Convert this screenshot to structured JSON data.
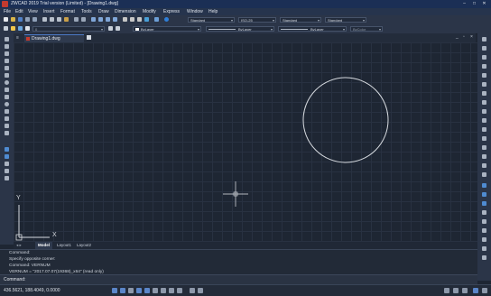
{
  "window": {
    "title": "ZWCAD 2019 Trial version (Limited) - [Drawing1.dwg]",
    "controls": {
      "minimize": "–",
      "maximize": "□",
      "close": "✕"
    }
  },
  "menu": [
    "File",
    "Edit",
    "View",
    "Insert",
    "Format",
    "Tools",
    "Draw",
    "Dimension",
    "Modify",
    "Express",
    "Window",
    "Help"
  ],
  "toolbar": {
    "text_style": "Standard",
    "dim_style": "ISO-25",
    "table_style": "Standard",
    "multileader_style": "Standard",
    "layer_color": "ByLayer",
    "linetype": "ByLayer",
    "lineweight": "ByLayer",
    "plot_style": "ByColor"
  },
  "document_tab": {
    "label": "Drawing1.dwg",
    "close_symbol": "×"
  },
  "ucs": {
    "x_label": "X",
    "y_label": "Y"
  },
  "layout_tabs": [
    "Model",
    "Layout1",
    "Layout2"
  ],
  "command_history": [
    "Command:",
    "Specify opposite corner:",
    "Command: VERNUM",
    "VERNUM = \"2017.07.07(19368)_x64\" (read only)"
  ],
  "command_prompt": "Command:",
  "status": {
    "coordinates": "436.5621, 188.4049, 0.0000"
  },
  "colors": {
    "canvas": "#1e2633",
    "grid": "#283141",
    "circle": "#d7dbe0",
    "accent": "#4d7ac7"
  },
  "icons": [
    "app-icon",
    "new-icon",
    "open-icon",
    "save-icon",
    "line-icon",
    "circle-icon",
    "arc-icon",
    "zoom-icon",
    "pan-icon",
    "gear-icon"
  ]
}
